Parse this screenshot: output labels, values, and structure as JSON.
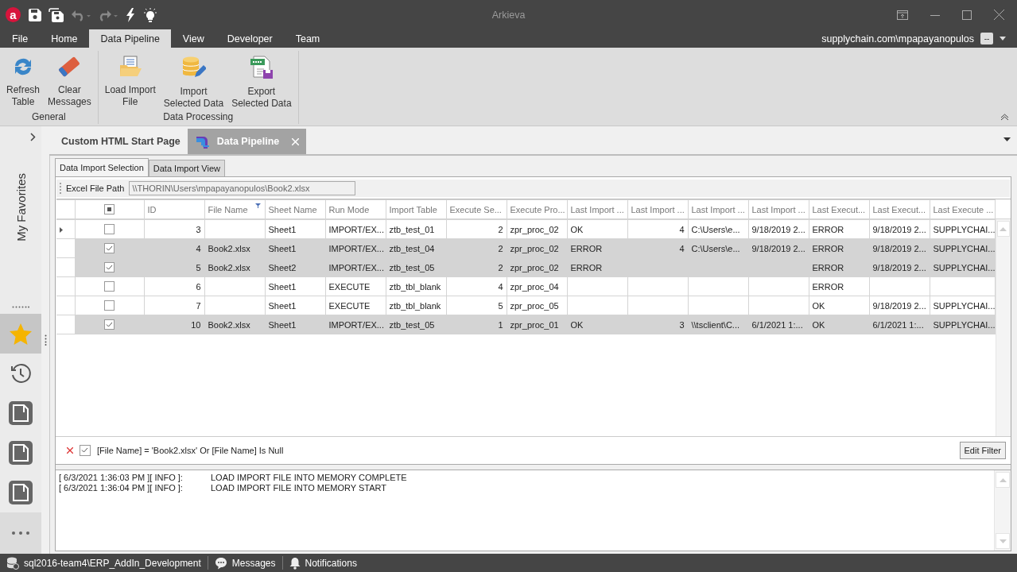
{
  "window": {
    "logo": "a",
    "title": "Arkieva"
  },
  "menu": {
    "items": [
      {
        "label": "File",
        "selected": false
      },
      {
        "label": "Home",
        "selected": false
      },
      {
        "label": "Data Pipeline",
        "selected": true
      },
      {
        "label": "View",
        "selected": false
      },
      {
        "label": "Developer",
        "selected": false
      },
      {
        "label": "Team",
        "selected": false
      }
    ],
    "user": "supplychain.com\\mpapayanopulos",
    "user_button": "--"
  },
  "ribbon": {
    "groups": [
      {
        "title": "General",
        "buttons": [
          {
            "lines": [
              "Refresh",
              "Table"
            ],
            "kind": "refresh"
          },
          {
            "lines": [
              "Clear",
              "Messages"
            ],
            "kind": "eraser"
          }
        ]
      },
      {
        "title": "Data Processing",
        "buttons": [
          {
            "lines": [
              "Load Import",
              "File"
            ],
            "kind": "folder"
          },
          {
            "lines": [
              "Import",
              "Selected Data"
            ],
            "kind": "database"
          },
          {
            "lines": [
              "Export",
              "Selected Data"
            ],
            "kind": "spreadsheet"
          }
        ]
      }
    ]
  },
  "sidebar": {
    "title": "My Favorites",
    "items": [
      {
        "kind": "star",
        "selected": true
      },
      {
        "kind": "history",
        "selected": false
      },
      {
        "kind": "page",
        "selected": false
      },
      {
        "kind": "page",
        "selected": false
      },
      {
        "kind": "page",
        "selected": false
      }
    ]
  },
  "doc_tabs": [
    {
      "label": "Custom HTML Start Page",
      "selected": false,
      "icon": false,
      "closable": false
    },
    {
      "label": "Data Pipeline",
      "selected": true,
      "icon": true,
      "closable": true
    }
  ],
  "view_tabs": [
    {
      "label": "Data Import Selection",
      "selected": true
    },
    {
      "label": "Data Import View",
      "selected": false
    }
  ],
  "file_path": {
    "label": "Excel File Path",
    "value": "\\\\THORIN\\Users\\mpapayanopulos\\Book2.xlsx"
  },
  "table": {
    "select_all_partial": true,
    "columns": [
      {
        "label": "ID",
        "filtered": false
      },
      {
        "label": "File Name",
        "filtered": true
      },
      {
        "label": "Sheet Name",
        "filtered": false
      },
      {
        "label": "Run Mode",
        "filtered": false
      },
      {
        "label": "Import Table",
        "filtered": false
      },
      {
        "label": "Execute Se...",
        "filtered": false
      },
      {
        "label": "Execute Pro...",
        "filtered": false
      },
      {
        "label": "Last Import ...",
        "filtered": false
      },
      {
        "label": "Last Import ...",
        "filtered": false
      },
      {
        "label": "Last Import ...",
        "filtered": false
      },
      {
        "label": "Last Import ...",
        "filtered": false
      },
      {
        "label": "Last Execut...",
        "filtered": false
      },
      {
        "label": "Last Execut...",
        "filtered": false
      },
      {
        "label": "Last Execute ...",
        "filtered": false
      }
    ],
    "rows": [
      {
        "current": true,
        "checked": false,
        "selected": false,
        "cells": [
          "3",
          null,
          "Sheet1",
          "IMPORT/EX...",
          "ztb_test_01",
          "2",
          "zpr_proc_02",
          "OK",
          "4",
          "C:\\Users\\e...",
          "9/18/2019 2...",
          "ERROR",
          "9/18/2019 2...",
          "SUPPLYCHAI..."
        ]
      },
      {
        "current": false,
        "checked": true,
        "selected": true,
        "cells": [
          "4",
          "Book2.xlsx",
          "Sheet1",
          "IMPORT/EX...",
          "ztb_test_04",
          "2",
          "zpr_proc_02",
          "ERROR",
          "4",
          "C:\\Users\\e...",
          "9/18/2019 2...",
          "ERROR",
          "9/18/2019 2...",
          "SUPPLYCHAI..."
        ]
      },
      {
        "current": false,
        "checked": true,
        "selected": true,
        "cells": [
          "5",
          "Book2.xlsx",
          "Sheet2",
          "IMPORT/EX...",
          "ztb_test_05",
          "2",
          "zpr_proc_02",
          "ERROR",
          null,
          null,
          null,
          "ERROR",
          "9/18/2019 2...",
          "SUPPLYCHAI..."
        ]
      },
      {
        "current": false,
        "checked": false,
        "selected": false,
        "cells": [
          "6",
          null,
          "Sheet1",
          "EXECUTE",
          "ztb_tbl_blank",
          "4",
          "zpr_proc_04",
          null,
          null,
          null,
          null,
          "ERROR",
          null,
          null
        ]
      },
      {
        "current": false,
        "checked": false,
        "selected": false,
        "cells": [
          "7",
          null,
          "Sheet1",
          "EXECUTE",
          "ztb_tbl_blank",
          "5",
          "zpr_proc_05",
          null,
          null,
          null,
          null,
          "OK",
          "9/18/2019 2...",
          "SUPPLYCHAI..."
        ]
      },
      {
        "current": false,
        "checked": true,
        "selected": true,
        "cells": [
          "10",
          "Book2.xlsx",
          "Sheet1",
          "IMPORT/EX...",
          "ztb_test_05",
          "1",
          "zpr_proc_01",
          "OK",
          "3",
          "\\\\tsclient\\C...",
          "6/1/2021 1:...",
          "OK",
          "6/1/2021 1:...",
          "SUPPLYCHAI..."
        ]
      }
    ]
  },
  "filter": {
    "enabled": true,
    "expression": "[File Name] = 'Book2.xlsx' Or [File Name] Is Null",
    "button": "Edit Filter"
  },
  "log": [
    {
      "stamp": "[ 6/3/2021 1:36:03 PM ][ INFO ]:",
      "message": "LOAD IMPORT FILE INTO MEMORY COMPLETE"
    },
    {
      "stamp": "[ 6/3/2021 1:36:04 PM ][ INFO ]:",
      "message": "LOAD IMPORT FILE INTO MEMORY START"
    }
  ],
  "status_bar": [
    {
      "kind": "database",
      "label": "sql2016-team4\\ERP_AddIn_Development"
    },
    {
      "kind": "chat",
      "label": "Messages"
    },
    {
      "kind": "bell",
      "label": "Notifications"
    }
  ]
}
